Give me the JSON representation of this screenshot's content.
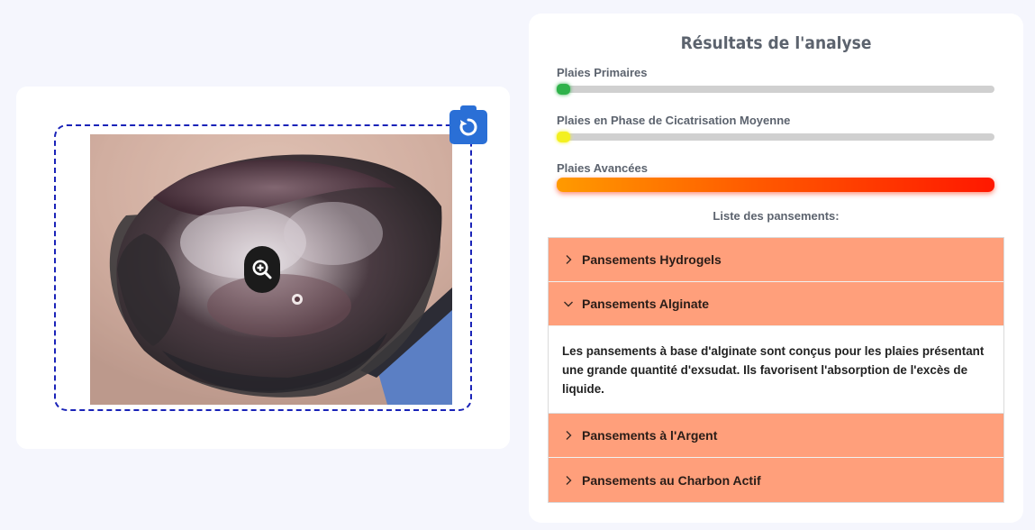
{
  "upload": {
    "zoom_icon": "zoom-in-icon",
    "retake_icon": "camera-rotate-icon"
  },
  "results": {
    "title": "Résultats de l'analyse",
    "metrics": [
      {
        "label": "Plaies Primaires",
        "level": 0.03,
        "color": "#2fb24a"
      },
      {
        "label": "Plaies en Phase de Cicatrisation Moyenne",
        "level": 0.02,
        "color": "#f3f020"
      },
      {
        "label": "Plaies Avancées",
        "level": 1.0,
        "color": "#ff3300"
      }
    ],
    "list_title": "Liste des pansements:",
    "dressings": [
      {
        "label": "Pansements Hydrogels",
        "expanded": false
      },
      {
        "label": "Pansements Alginate",
        "expanded": true,
        "description": "Les pansements à base d'alginate sont conçus pour les plaies présentant une grande quantité d'exsudat. Ils favorisent l'absorption de l'excès de liquide."
      },
      {
        "label": "Pansements à l'Argent",
        "expanded": false
      },
      {
        "label": "Pansements au Charbon Actif",
        "expanded": false
      }
    ]
  },
  "colors": {
    "accent_blue": "#2a6fd6",
    "dropzone_border": "#1a23b8",
    "accordion_header": "#ff9f7b"
  }
}
